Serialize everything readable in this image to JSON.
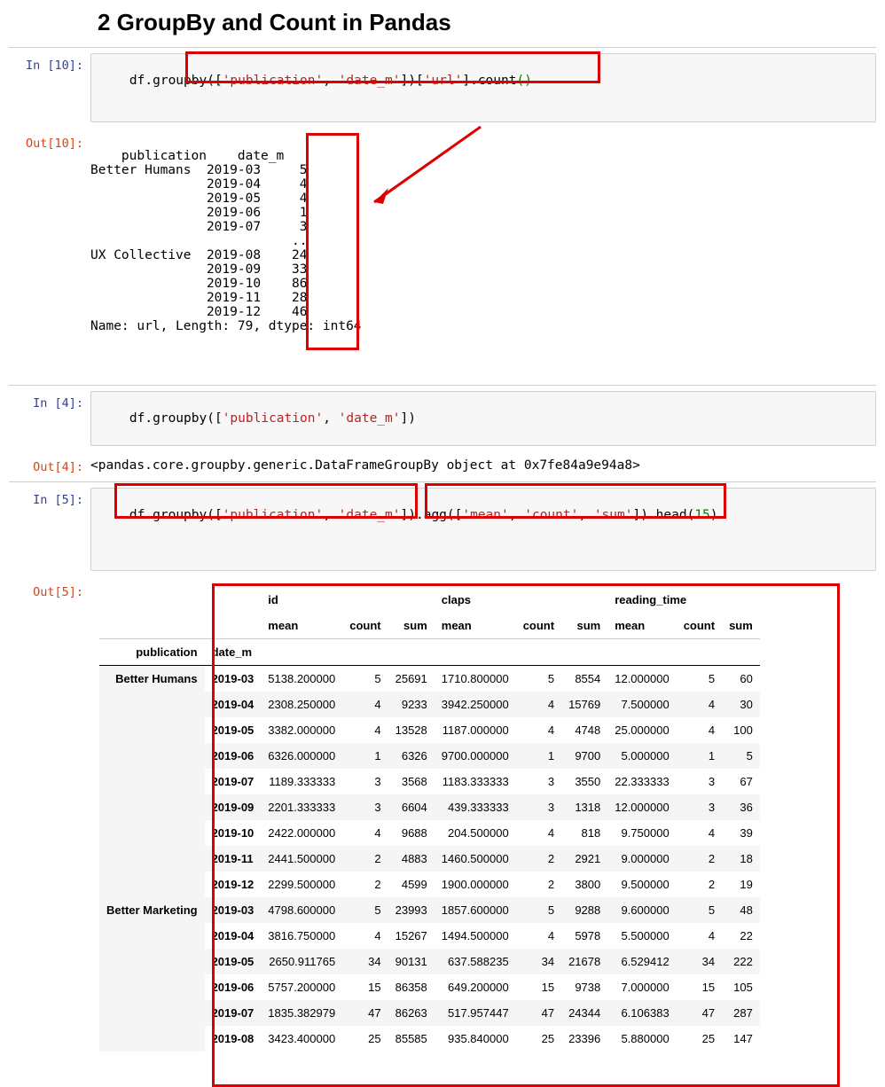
{
  "heading": "2  GroupBy and Count in Pandas",
  "cells": {
    "in10_prompt": "In [10]:",
    "in10_code_pre": "df.groupby([",
    "in10_code_s1": "'publication'",
    "in10_code_comma": ", ",
    "in10_code_s2": "'date_m'",
    "in10_code_post": "])[",
    "in10_code_s3": "'url'",
    "in10_code_after": "].count",
    "in10_code_paren": "()",
    "out10_prompt": "Out[10]:",
    "out10_text": "publication    date_m \nBetter Humans  2019-03     5\n               2019-04     4\n               2019-05     4\n               2019-06     1\n               2019-07     3\n                          ..\nUX Collective  2019-08    24\n               2019-09    33\n               2019-10    86\n               2019-11    28\n               2019-12    46\nName: url, Length: 79, dtype: int64",
    "in4_prompt": "In [4]:",
    "in4_code_pre": "df.groupby([",
    "in4_code_s1": "'publication'",
    "in4_code_comma": ", ",
    "in4_code_s2": "'date_m'",
    "in4_code_post": "])",
    "out4_prompt": "Out[4]:",
    "out4_text": "<pandas.core.groupby.generic.DataFrameGroupBy object at 0x7fe84a9e94a8>",
    "in5_prompt": "In [5]:",
    "in5_code_pre": "df.",
    "in5_code_gb": "groupby([",
    "in5_code_s1": "'publication'",
    "in5_code_comma": ", ",
    "in5_code_s2": "'date_m'",
    "in5_code_mid": "]).",
    "in5_code_agg": "agg([",
    "in5_code_as1": "'mean'",
    "in5_code_c2": ", ",
    "in5_code_as2": "'count'",
    "in5_code_c3": ", ",
    "in5_code_as3": "'sum'",
    "in5_code_aggend": "]).",
    "in5_code_head": "head(",
    "in5_code_num": "15",
    "in5_code_end": ")",
    "out5_prompt": "Out[5]:"
  },
  "table": {
    "top_cols": [
      "id",
      "claps",
      "reading_time"
    ],
    "sub_cols": [
      "mean",
      "count",
      "sum"
    ],
    "idx_labels": [
      "publication",
      "date_m"
    ],
    "rows": [
      {
        "pub": "Better Humans",
        "date": "2019-03",
        "vals": [
          "5138.200000",
          "5",
          "25691",
          "1710.800000",
          "5",
          "8554",
          "12.000000",
          "5",
          "60"
        ]
      },
      {
        "pub": "",
        "date": "2019-04",
        "vals": [
          "2308.250000",
          "4",
          "9233",
          "3942.250000",
          "4",
          "15769",
          "7.500000",
          "4",
          "30"
        ]
      },
      {
        "pub": "",
        "date": "2019-05",
        "vals": [
          "3382.000000",
          "4",
          "13528",
          "1187.000000",
          "4",
          "4748",
          "25.000000",
          "4",
          "100"
        ]
      },
      {
        "pub": "",
        "date": "2019-06",
        "vals": [
          "6326.000000",
          "1",
          "6326",
          "9700.000000",
          "1",
          "9700",
          "5.000000",
          "1",
          "5"
        ]
      },
      {
        "pub": "",
        "date": "2019-07",
        "vals": [
          "1189.333333",
          "3",
          "3568",
          "1183.333333",
          "3",
          "3550",
          "22.333333",
          "3",
          "67"
        ]
      },
      {
        "pub": "",
        "date": "2019-09",
        "vals": [
          "2201.333333",
          "3",
          "6604",
          "439.333333",
          "3",
          "1318",
          "12.000000",
          "3",
          "36"
        ]
      },
      {
        "pub": "",
        "date": "2019-10",
        "vals": [
          "2422.000000",
          "4",
          "9688",
          "204.500000",
          "4",
          "818",
          "9.750000",
          "4",
          "39"
        ]
      },
      {
        "pub": "",
        "date": "2019-11",
        "vals": [
          "2441.500000",
          "2",
          "4883",
          "1460.500000",
          "2",
          "2921",
          "9.000000",
          "2",
          "18"
        ]
      },
      {
        "pub": "",
        "date": "2019-12",
        "vals": [
          "2299.500000",
          "2",
          "4599",
          "1900.000000",
          "2",
          "3800",
          "9.500000",
          "2",
          "19"
        ]
      },
      {
        "pub": "Better Marketing",
        "date": "2019-03",
        "vals": [
          "4798.600000",
          "5",
          "23993",
          "1857.600000",
          "5",
          "9288",
          "9.600000",
          "5",
          "48"
        ]
      },
      {
        "pub": "",
        "date": "2019-04",
        "vals": [
          "3816.750000",
          "4",
          "15267",
          "1494.500000",
          "4",
          "5978",
          "5.500000",
          "4",
          "22"
        ]
      },
      {
        "pub": "",
        "date": "2019-05",
        "vals": [
          "2650.911765",
          "34",
          "90131",
          "637.588235",
          "34",
          "21678",
          "6.529412",
          "34",
          "222"
        ]
      },
      {
        "pub": "",
        "date": "2019-06",
        "vals": [
          "5757.200000",
          "15",
          "86358",
          "649.200000",
          "15",
          "9738",
          "7.000000",
          "15",
          "105"
        ]
      },
      {
        "pub": "",
        "date": "2019-07",
        "vals": [
          "1835.382979",
          "47",
          "86263",
          "517.957447",
          "47",
          "24344",
          "6.106383",
          "47",
          "287"
        ]
      },
      {
        "pub": "",
        "date": "2019-08",
        "vals": [
          "3423.400000",
          "25",
          "85585",
          "935.840000",
          "25",
          "23396",
          "5.880000",
          "25",
          "147"
        ]
      }
    ]
  }
}
